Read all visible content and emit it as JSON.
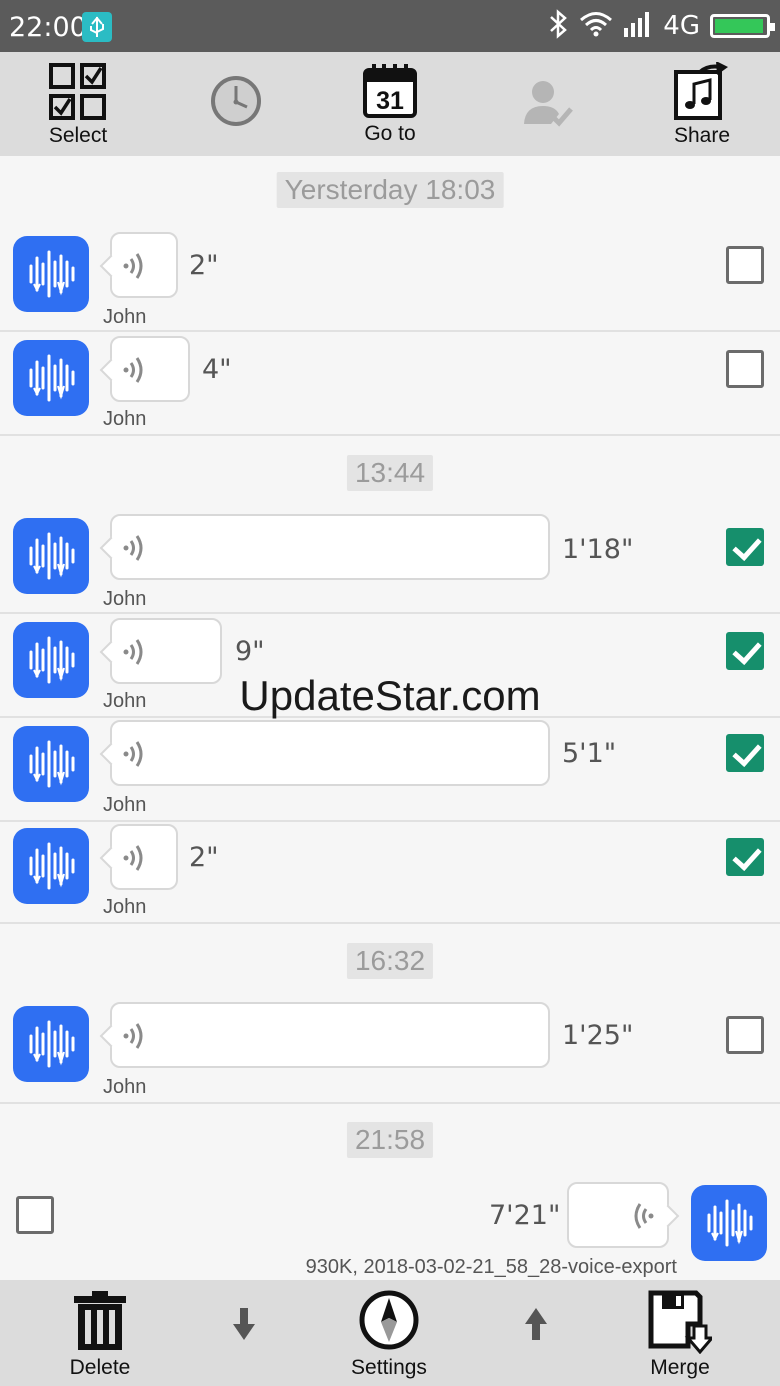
{
  "status_bar": {
    "time": "22:00",
    "network": "4G",
    "battery_level": 0.95,
    "icons": [
      "usb-icon",
      "bluetooth-icon",
      "wifi-icon",
      "signal-icon",
      "battery-icon"
    ]
  },
  "toolbar": {
    "select_label": "Select",
    "goto_label": "Go to",
    "goto_calendar_day": "31",
    "share_label": "Share",
    "icons": [
      "select-grid-icon",
      "clock-icon",
      "calendar-icon",
      "user-check-icon",
      "share-music-icon"
    ]
  },
  "timestamps": {
    "t1": "Yersterday 18:03",
    "t2": "13:44",
    "t3": "16:32",
    "t4": "21:58"
  },
  "messages": [
    {
      "sender": "John",
      "duration": "2\"",
      "checked": false
    },
    {
      "sender": "John",
      "duration": "4\"",
      "checked": false
    },
    {
      "sender": "John",
      "duration": "1'18\"",
      "checked": true
    },
    {
      "sender": "John",
      "duration": "9\"",
      "checked": true
    },
    {
      "sender": "John",
      "duration": "5'1\"",
      "checked": true
    },
    {
      "sender": "John",
      "duration": "2\"",
      "checked": true
    },
    {
      "sender": "John",
      "duration": "1'25\"",
      "checked": false
    }
  ],
  "outgoing": {
    "duration": "7'21\"",
    "file_info": "930K, 2018-03-02-21_58_28-voice-export",
    "checked": false
  },
  "watermark": "UpdateStar.com",
  "bottom_bar": {
    "delete_label": "Delete",
    "settings_label": "Settings",
    "merge_label": "Merge",
    "icons": [
      "trash-icon",
      "arrow-down-icon",
      "compass-icon",
      "arrow-up-icon",
      "save-merge-icon"
    ]
  },
  "colors": {
    "accent_blue": "#2f6ff2",
    "check_green": "#168f6c",
    "status_bar": "#5b5b5b",
    "toolbar": "#dcdcdc"
  }
}
